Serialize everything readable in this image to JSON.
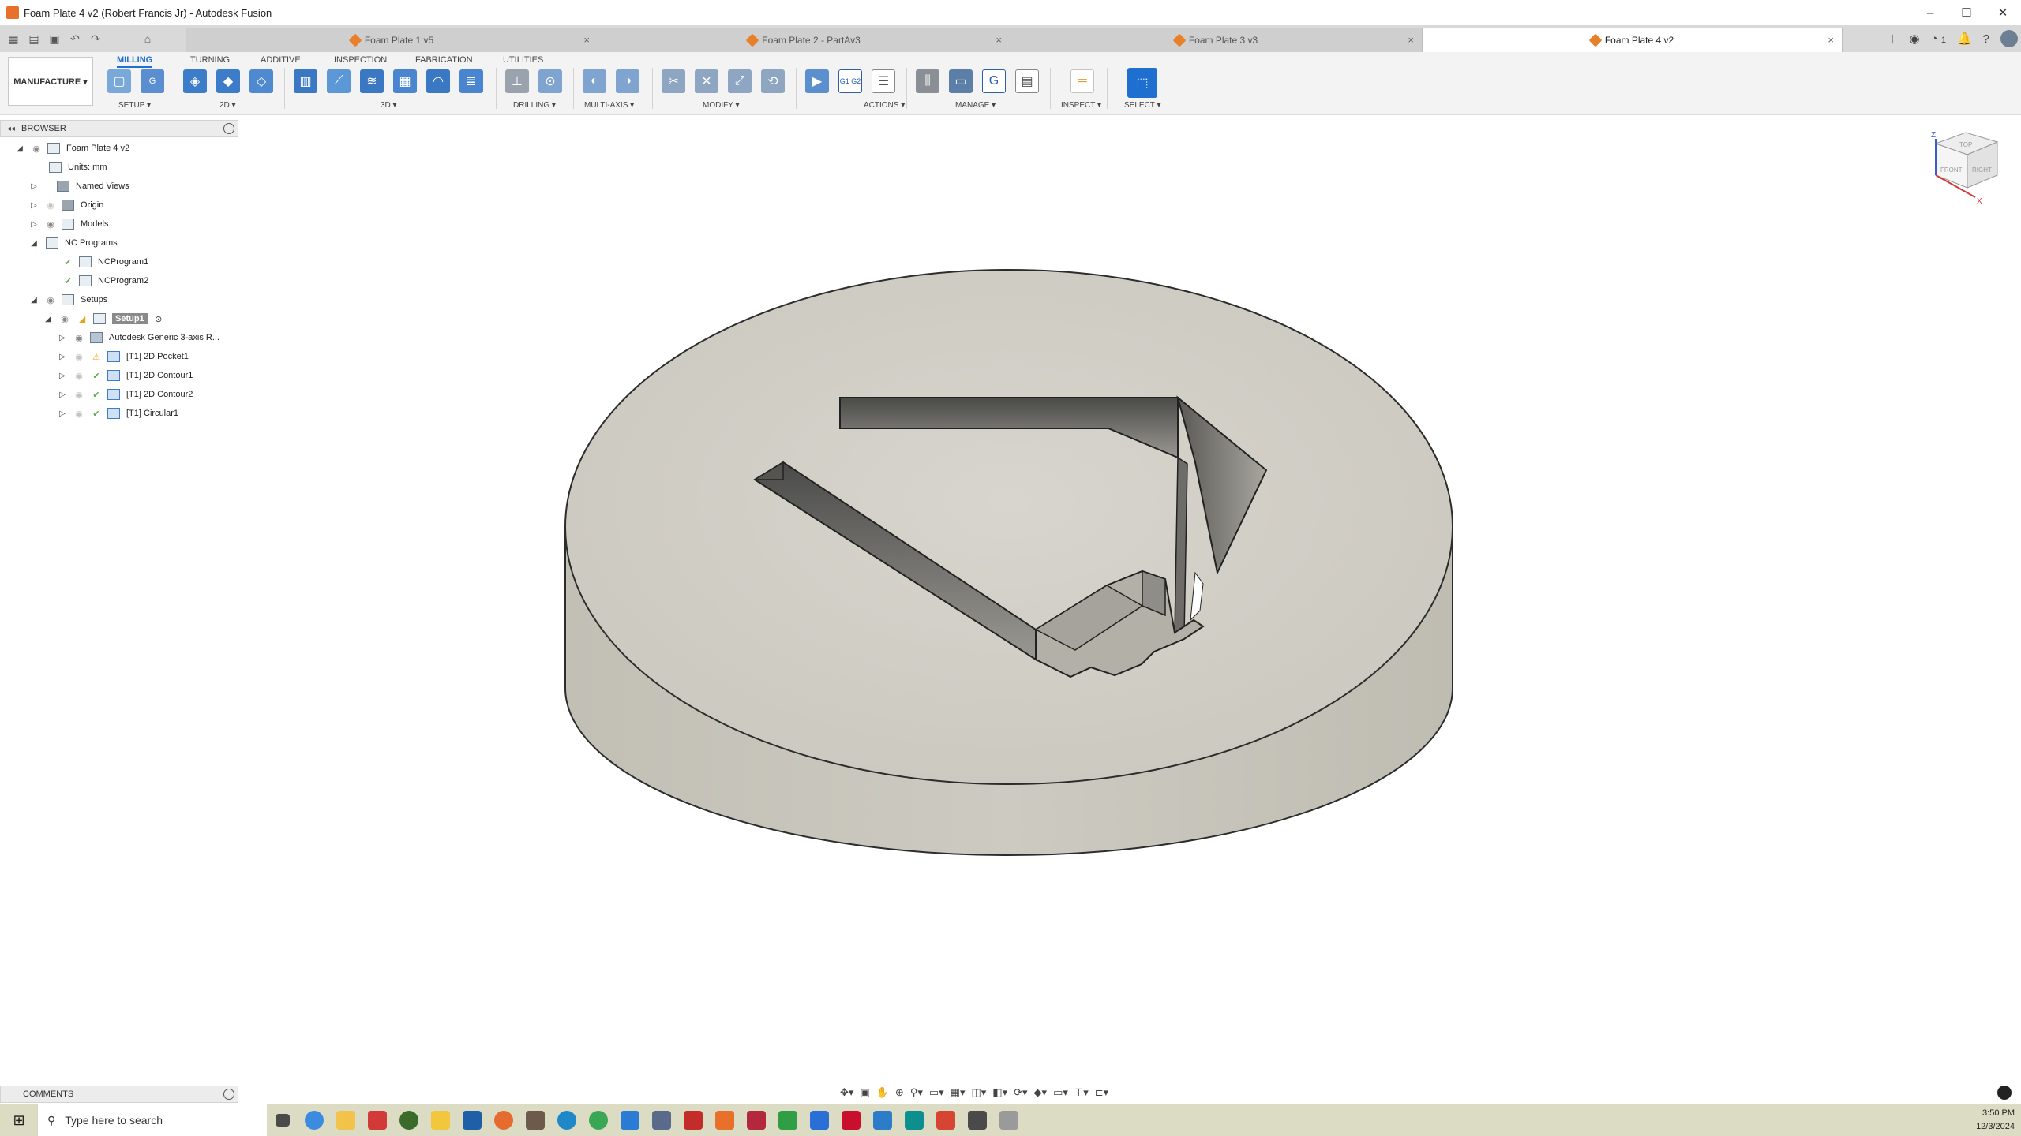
{
  "window": {
    "title": "Foam Plate 4 v2 (Robert Francis Jr) - Autodesk Fusion",
    "controls": {
      "minimize": "–",
      "maximize": "☐",
      "close": "✕"
    }
  },
  "tabs": [
    {
      "label": "Foam Plate 1 v5",
      "active": false
    },
    {
      "label": "Foam Plate 2 - PartAv3",
      "active": false
    },
    {
      "label": "Foam Plate 3 v3",
      "active": false
    },
    {
      "label": "Foam Plate 4 v2",
      "active": true
    }
  ],
  "tab_close": "×",
  "tabbar_right": {
    "jobs_count": "1"
  },
  "workspace": {
    "label": "MANUFACTURE ▾"
  },
  "ribbon_tabs": [
    "MILLING",
    "TURNING",
    "ADDITIVE",
    "INSPECTION",
    "FABRICATION",
    "UTILITIES"
  ],
  "ribbon_groups": [
    "SETUP ▾",
    "2D ▾",
    "3D ▾",
    "DRILLING ▾",
    "MULTI-AXIS ▾",
    "MODIFY ▾",
    "ACTIONS ▾",
    "MANAGE ▾",
    "INSPECT ▾",
    "SELECT ▾"
  ],
  "ribbon_icon_text": {
    "nc": "G",
    "g1g2": "G1 G2"
  },
  "browser": {
    "title": "BROWSER",
    "root": "Foam Plate 4 v2",
    "units": "Units: mm",
    "items": [
      "Named Views",
      "Origin",
      "Models",
      "NC Programs"
    ],
    "nc_programs": [
      "NCProgram1",
      "NCProgram2"
    ],
    "setups_label": "Setups",
    "setup": "Setup1",
    "operations": [
      "Autodesk Generic 3-axis R...",
      "[T1] 2D Pocket1",
      "[T1] 2D Contour1",
      "[T1] 2D Contour2",
      "[T1] Circular1"
    ]
  },
  "viewcube": {
    "top": "TOP",
    "front": "FRONT",
    "right": "RIGHT",
    "axis_x": "X",
    "axis_z": "Z"
  },
  "comments": {
    "title": "COMMENTS"
  },
  "taskbar": {
    "search_placeholder": "Type here to search",
    "time": "3:50 PM",
    "date": "12/3/2024"
  },
  "colors": {
    "accent": "#1f6fd1",
    "foam_top": "#d3d0c8",
    "foam_side": "#c6c3b9",
    "taskbar": "#dcdcc4",
    "warning": "#e8a317",
    "ok": "#5aa848"
  }
}
